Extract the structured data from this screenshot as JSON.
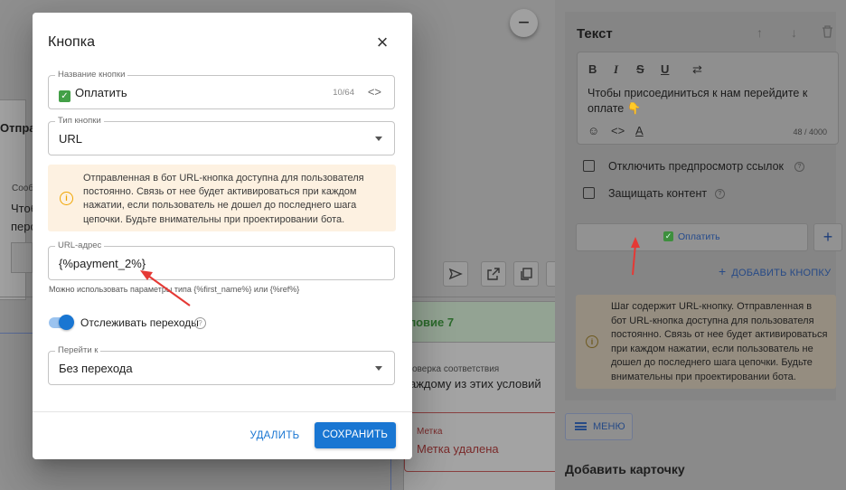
{
  "canvas": {
    "node_header_partial": "Отпра",
    "message_label_partial": "Сооб",
    "message_text_line1": "Чтоб",
    "message_text_line2": "перс",
    "condition_title": "ловие 7",
    "check_label": "оверка соответствия",
    "check_value": "аждому из этих условий",
    "tag_label": "Метка",
    "tag_value": "Метка удалена",
    "zoom_out": "−"
  },
  "panel": {
    "title": "Текст",
    "text": "Чтобы присоединиться к нам перейдите к оплате 👇",
    "char_count": "48 / 4000",
    "disable_preview_label": "Отключить предпросмотр ссылок",
    "protect_content_label": "Защищать контент",
    "button_label": "Оплатить",
    "add_button_label": "ДОБАВИТЬ КНОПКУ",
    "warning_text": "Шаг содержит URL-кнопку. Отправленная в бот URL-кнопка доступна для пользователя постоянно. Связь от нее будет активироваться при каждом нажатии, если пользователь не дошел до последнего шага цепочки. Будьте внимательны при проектировании бота.",
    "menu_label": "МЕНЮ",
    "add_card_label": "Добавить карточку"
  },
  "modal": {
    "title": "Кнопка",
    "name_field": {
      "legend": "Название кнопки",
      "value": "Оплатить",
      "counter": "10/64"
    },
    "type_field": {
      "legend": "Тип кнопки",
      "value": "URL"
    },
    "alert_text": "Отправленная в бот URL-кнопка доступна для пользователя постоянно. Связь от нее будет активироваться при каждом нажатии, если пользователь не дошел до последнего шага цепочки. Будьте внимательны при проектировании бота.",
    "url_field": {
      "legend": "URL-адрес",
      "value": "{%payment_2%}"
    },
    "url_hint": "Можно использовать параметры типа {%first_name%} или {%ref%}",
    "track_label": "Отслеживать переходы",
    "track_enabled": true,
    "goto_field": {
      "legend": "Перейти к",
      "value": "Без перехода"
    },
    "delete_label": "УДАЛИТЬ",
    "save_label": "СОХРАНИТЬ"
  },
  "colors": {
    "primary": "#1976d2",
    "alert_bg": "#fdf1e1",
    "alert_icon": "#f0a500",
    "annotation_arrow": "#e53935",
    "overlay": "#8f8f8f"
  }
}
